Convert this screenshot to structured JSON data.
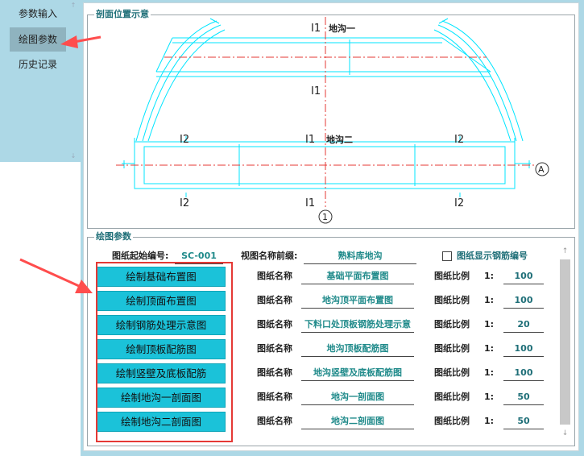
{
  "sidebar": {
    "items": [
      {
        "label": "参数输入",
        "active": false
      },
      {
        "label": "绘图参数",
        "active": true
      },
      {
        "label": "历史记录",
        "active": false
      }
    ]
  },
  "section_view": {
    "title": "剖面位置示意",
    "labels": {
      "trench1": "地沟一",
      "trench2": "地沟二",
      "l1_top": "I1",
      "l1_mid_top": "I1",
      "l1_mid": "I1",
      "l1_bottom": "I1",
      "l2_left_top": "I2",
      "l2_left_bottom": "I2",
      "l2_right_top": "I2",
      "l2_right_bottom": "I2",
      "axis_a": "A",
      "axis_1": "1"
    }
  },
  "drawing_params": {
    "title": "绘图参数",
    "start_number_label": "图纸起始编号:",
    "start_number_value": "SC-001",
    "prefix_label": "视图名称前缀:",
    "prefix_value": "熟料库地沟",
    "show_rebar_label": "图纸显示钢筋编号",
    "show_rebar_checked": false,
    "drawing_name_label": "图纸名称",
    "scale_label": "图纸比例",
    "scale_prefix": "1:",
    "rows": [
      {
        "button": "绘制基础布置图",
        "name": "基础平面布置图",
        "scale": "100"
      },
      {
        "button": "绘制顶面布置图",
        "name": "地沟顶平面布置图",
        "scale": "100"
      },
      {
        "button": "绘制钢筋处理示意图",
        "name": "下料口处顶板钢筋处理示意",
        "scale": "20"
      },
      {
        "button": "绘制顶板配筋图",
        "name": "地沟顶板配筋图",
        "scale": "100"
      },
      {
        "button": "绘制竖壁及底板配筋",
        "name": "地沟竖壁及底板配筋图",
        "scale": "100"
      },
      {
        "button": "绘制地沟一剖面图",
        "name": "地沟一剖面图",
        "scale": "50"
      },
      {
        "button": "绘制地沟二剖面图",
        "name": "地沟二剖面图",
        "scale": "50"
      }
    ]
  },
  "colors": {
    "panel_bg": "#add8e6",
    "button_bg": "#1bc2d9",
    "drawing_line": "#00e5ff",
    "center_line": "#e53935",
    "annotation_arrow": "#ff4d4d",
    "value_text": "#1f8a8a"
  }
}
